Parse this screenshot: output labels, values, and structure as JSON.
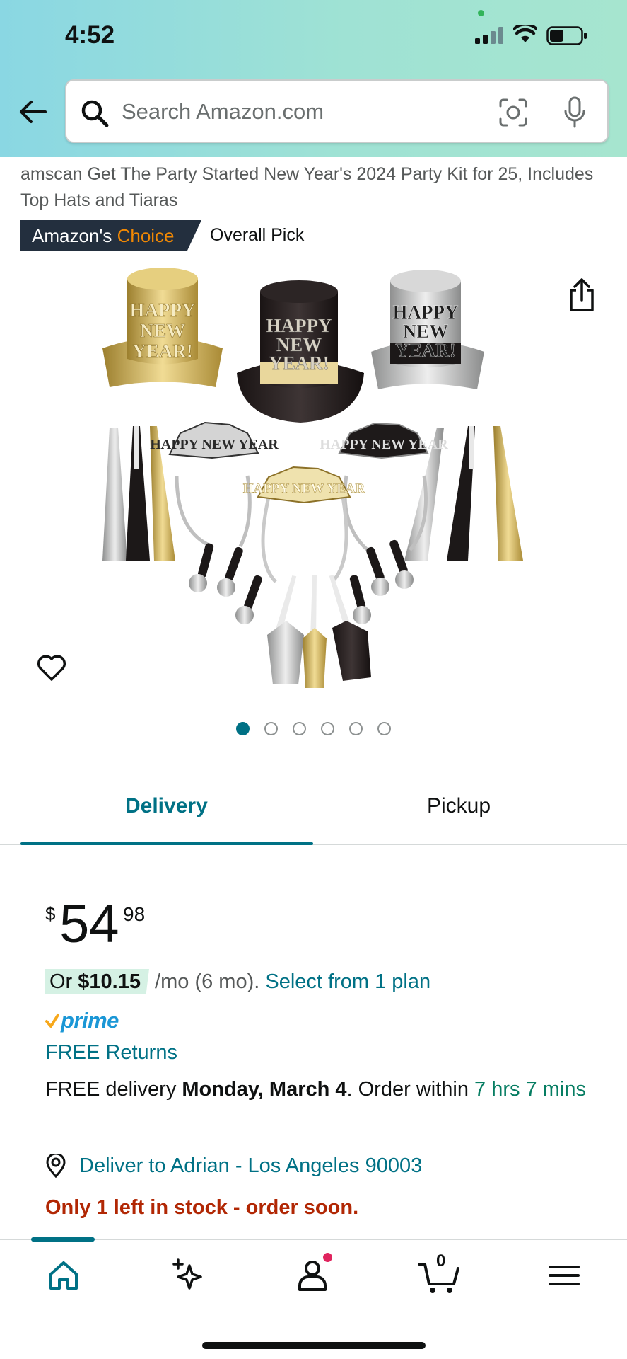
{
  "status_bar": {
    "time": "4:52"
  },
  "search": {
    "placeholder": "Search Amazon.com"
  },
  "product": {
    "title": "amscan Get The Party Started New Year's 2024 Party Kit for 25, Includes Top Hats and Tiaras",
    "badge_prefix": "Amazon's",
    "badge_choice": "Choice",
    "badge_pick": "Overall Pick",
    "image_hat_text": [
      "HAPPY",
      "NEW",
      "YEAR!"
    ],
    "image_tiara_text": "HAPPY NEW YEAR",
    "image_count": 6,
    "active_image_index": 0
  },
  "tabs": {
    "delivery": "Delivery",
    "pickup": "Pickup"
  },
  "price": {
    "symbol": "$",
    "whole": "54",
    "fraction": "98"
  },
  "installment": {
    "or": "Or",
    "amount": "$10.15",
    "term": "/mo (6 mo).",
    "link": "Select from 1 plan"
  },
  "prime": {
    "word": "prime"
  },
  "free_returns": "FREE Returns",
  "delivery": {
    "prefix": "FREE delivery",
    "date": "Monday, March 4",
    "mid": ". Order within",
    "countdown": "7 hrs 7 mins"
  },
  "deliver_to": "Deliver to Adrian - Los Angeles 90003",
  "stock": "Only 1 left in stock - order soon.",
  "bottom_nav": {
    "cart_count": "0"
  },
  "colors": {
    "link": "#007185",
    "stock": "#b12704",
    "badge_bg": "#232f3e",
    "badge_choice": "#f08804",
    "countdown": "#067d62",
    "prime": "#1b97d6"
  }
}
